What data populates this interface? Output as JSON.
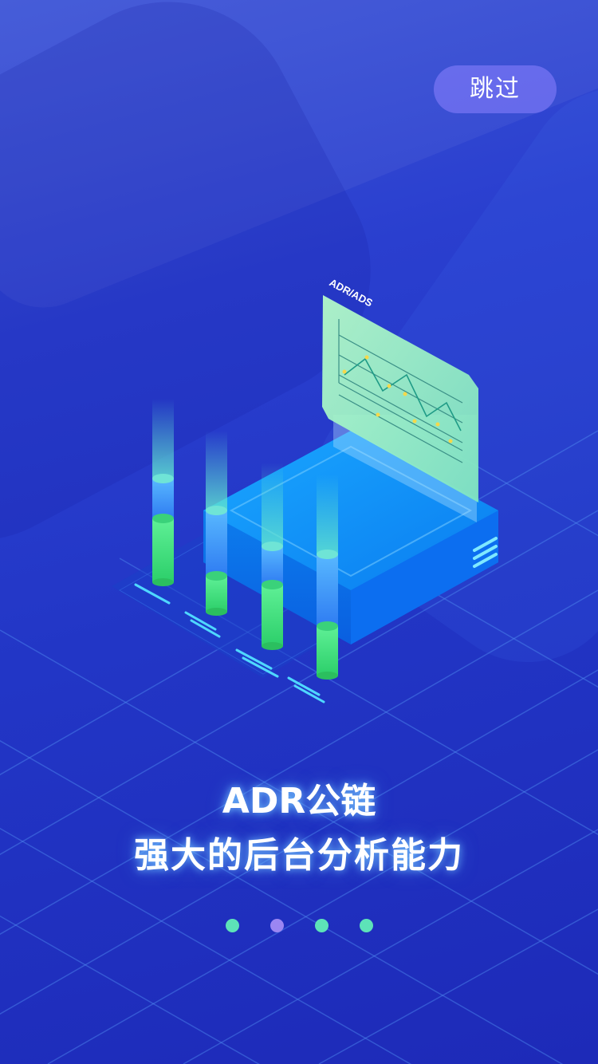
{
  "skip_button": {
    "label": "跳过"
  },
  "illustration": {
    "panel_title": "ADR/ADS"
  },
  "caption": {
    "line1": "ADR公链",
    "line2": "强大的后台分析能力"
  },
  "pager": {
    "count": 4,
    "active_index": 1
  },
  "colors": {
    "background": "#2a3fcf",
    "accent_green": "#5de3b8",
    "accent_purple": "#9b86f2",
    "skip_button_bg": "#8c82ff"
  }
}
